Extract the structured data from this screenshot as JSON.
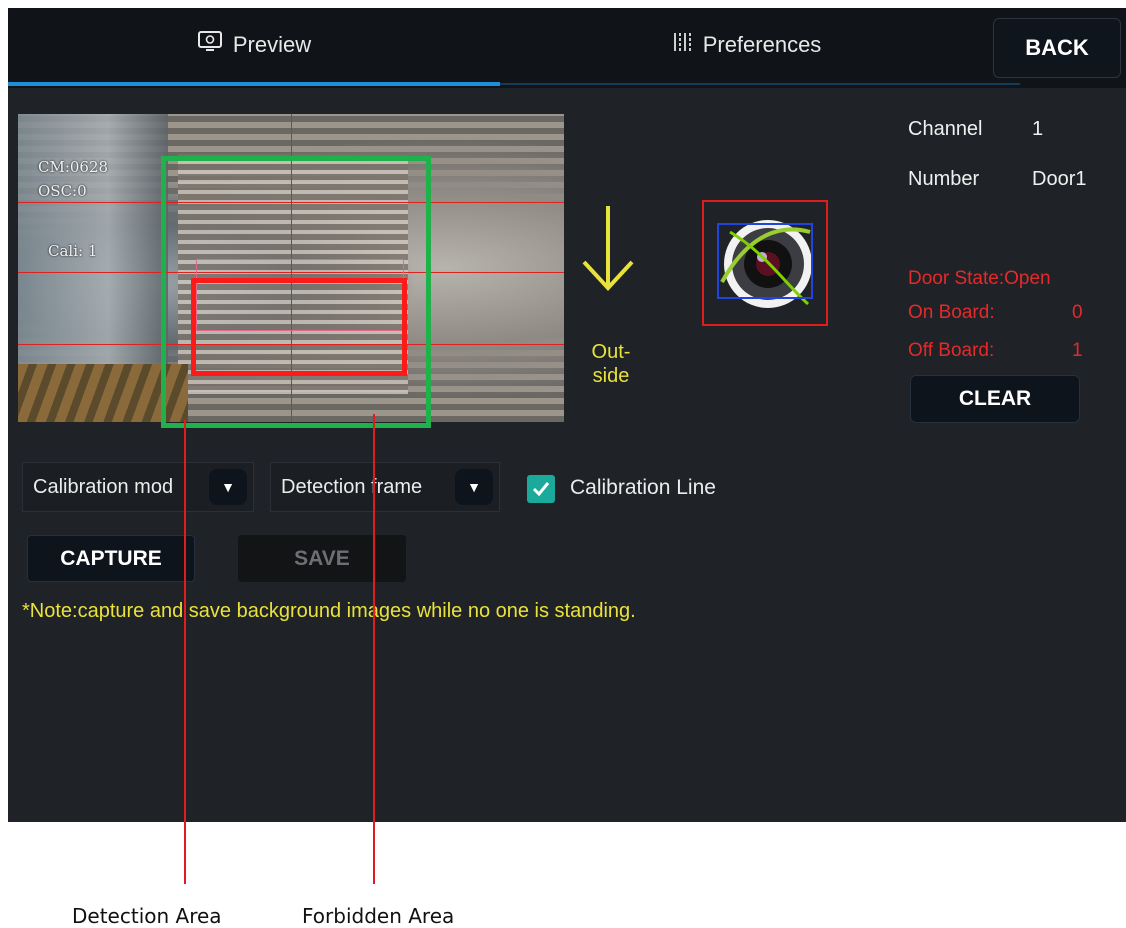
{
  "topbar": {
    "tabs": [
      {
        "label": "Preview",
        "icon": "monitor-icon",
        "active": true
      },
      {
        "label": "Preferences",
        "icon": "sliders-icon",
        "active": false
      }
    ],
    "back_label": "BACK",
    "accent_color": "#1f8fdc"
  },
  "camera": {
    "overlay": {
      "cm": "CM:0628",
      "osc": "OSC:0",
      "cali": "Cali: 1"
    },
    "detection_color": "#1fb24a",
    "forbidden_color": "#ff1a1a"
  },
  "direction": {
    "icon": "arrow-down-icon",
    "label_line1": "Out-",
    "label_line2": "side",
    "color": "#e9e23a"
  },
  "info": {
    "channel_label": "Channel",
    "channel_value": "1",
    "number_label": "Number",
    "number_value": "Door1"
  },
  "status": {
    "door_state": "Door State:Open",
    "on_board_label": "On Board:",
    "on_board_value": "0",
    "off_board_label": "Off Board:",
    "off_board_value": "1",
    "color": "#e52a2a",
    "clear_label": "CLEAR"
  },
  "controls": {
    "calibration_mode": "Calibration mod",
    "detection_frame": "Detection frame",
    "calibration_line_label": "Calibration Line",
    "calibration_line_checked": true,
    "capture_label": "CAPTURE",
    "save_label": "SAVE"
  },
  "note": "*Note:capture and save background images while no one is standing.",
  "callouts": {
    "detection": "Detection Area",
    "forbidden": "Forbidden Area"
  }
}
